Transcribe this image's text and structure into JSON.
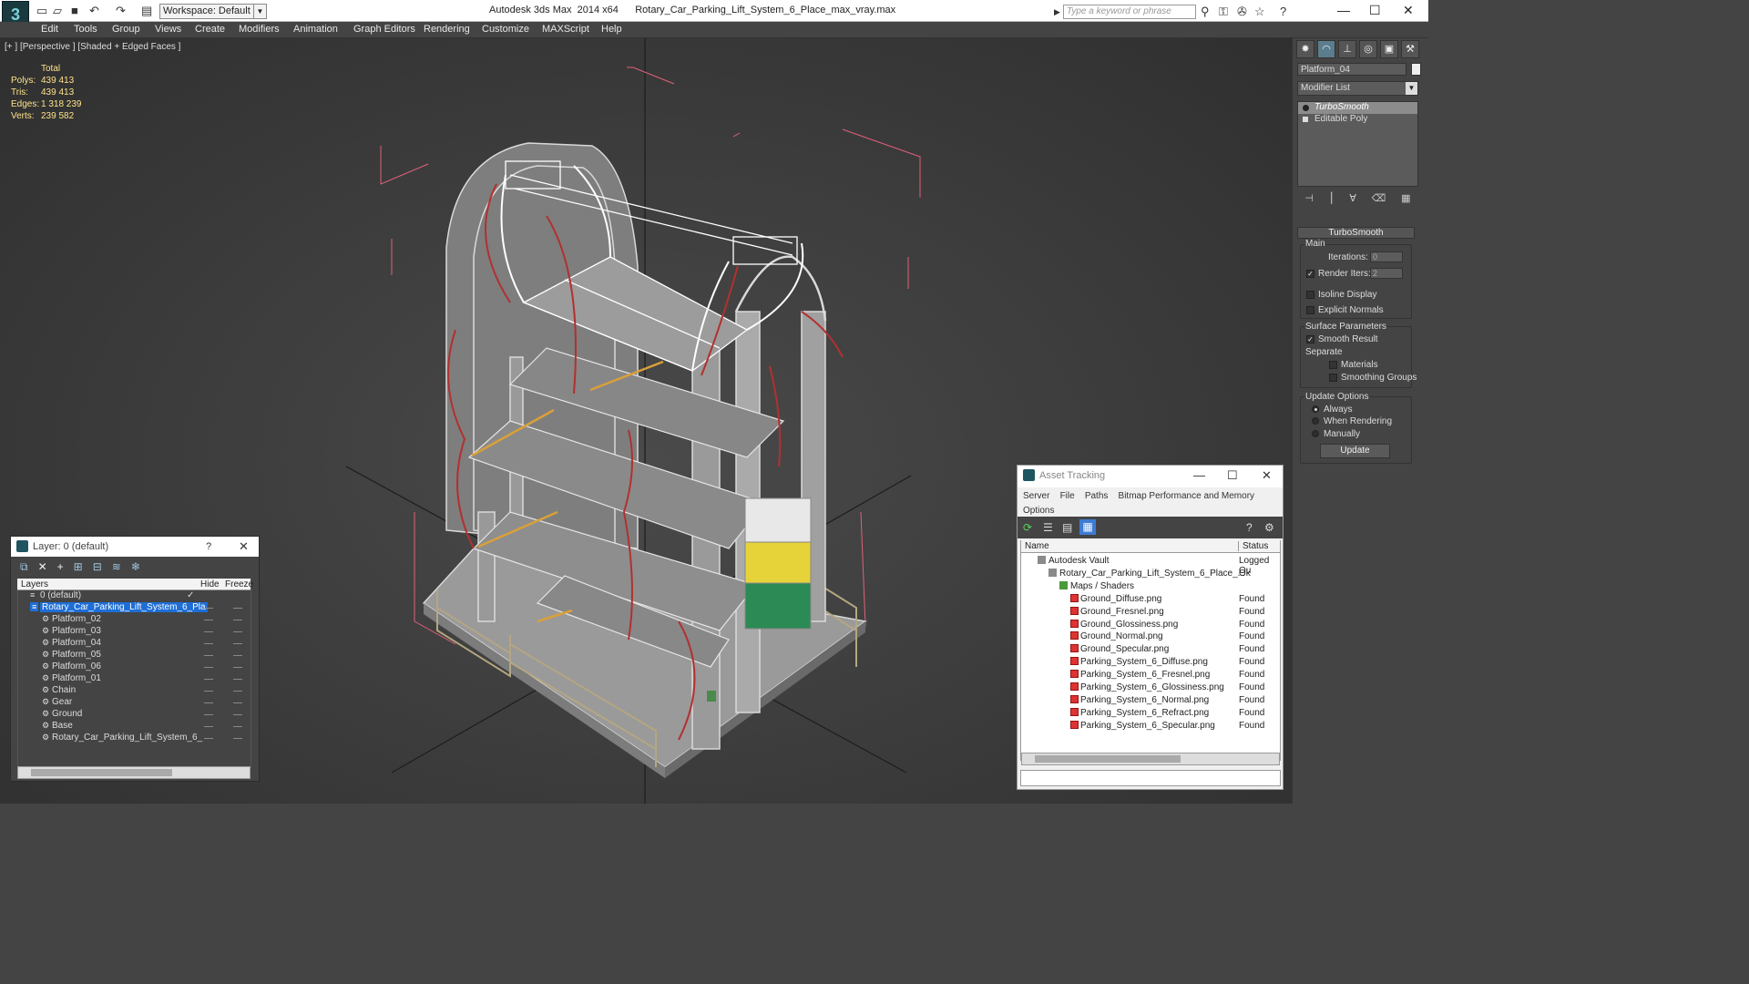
{
  "app": {
    "workspace_label": "Workspace: Default",
    "product": "Autodesk 3ds Max  2014 x64",
    "filename": "Rotary_Car_Parking_Lift_System_6_Place_max_vray.max",
    "search_placeholder": "Type a keyword or phrase"
  },
  "menu": [
    "Edit",
    "Tools",
    "Group",
    "Views",
    "Create",
    "Modifiers",
    "Animation",
    "Graph Editors",
    "Rendering",
    "Customize",
    "MAXScript",
    "Help"
  ],
  "viewport": {
    "label": "[+ ] [Perspective ] [Shaded + Edged Faces ]",
    "stats_header": "Total",
    "stats": [
      {
        "k": "Polys:",
        "v": "439 413"
      },
      {
        "k": "Tris:",
        "v": "439 413"
      },
      {
        "k": "Edges:",
        "v": "1 318 239"
      },
      {
        "k": "Verts:",
        "v": "239 582"
      }
    ]
  },
  "command_panel": {
    "object_name": "Platform_04",
    "modifier_list": "Modifier List",
    "stack": [
      "TurboSmooth",
      "Editable Poly"
    ],
    "rollout": "TurboSmooth",
    "main": "Main",
    "iterations_label": "Iterations:",
    "iterations_value": "0",
    "render_iters_label": "Render Iters:",
    "render_iters_value": "2",
    "isoline": "Isoline Display",
    "explicit": "Explicit Normals",
    "surface_params": "Surface Parameters",
    "smooth_result": "Smooth Result",
    "separate": "Separate",
    "materials": "Materials",
    "smoothing_groups": "Smoothing Groups",
    "update_options": "Update Options",
    "always": "Always",
    "when_rendering": "When Rendering",
    "manually": "Manually",
    "update_btn": "Update"
  },
  "layer_dialog": {
    "title": "Layer: 0 (default)",
    "help": "?",
    "col_layers": "Layers",
    "col_hide": "Hide",
    "col_freeze": "Freeze",
    "rows": [
      {
        "name": "0 (default)",
        "indent": 1,
        "check": true
      },
      {
        "name": "Rotary_Car_Parking_Lift_System_6_Pla",
        "indent": 1,
        "sel": true
      },
      {
        "name": "Platform_02",
        "indent": 2
      },
      {
        "name": "Platform_03",
        "indent": 2
      },
      {
        "name": "Platform_04",
        "indent": 2
      },
      {
        "name": "Platform_05",
        "indent": 2
      },
      {
        "name": "Platform_06",
        "indent": 2
      },
      {
        "name": "Platform_01",
        "indent": 2
      },
      {
        "name": "Chain",
        "indent": 2
      },
      {
        "name": "Gear",
        "indent": 2
      },
      {
        "name": "Ground",
        "indent": 2
      },
      {
        "name": "Base",
        "indent": 2
      },
      {
        "name": "Rotary_Car_Parking_Lift_System_6_",
        "indent": 2
      }
    ]
  },
  "asset_dialog": {
    "title": "Asset Tracking",
    "menu": [
      "Server",
      "File",
      "Paths",
      "Bitmap Performance and Memory",
      "Options"
    ],
    "col_name": "Name",
    "col_status": "Status",
    "rows": [
      {
        "name": "Autodesk Vault",
        "status": "Logged Ou",
        "indent": 1
      },
      {
        "name": "Rotary_Car_Parking_Lift_System_6_Place_...",
        "status": "Ok",
        "indent": 2
      },
      {
        "name": "Maps / Shaders",
        "status": "",
        "indent": 3
      },
      {
        "name": "Ground_Diffuse.png",
        "status": "Found",
        "indent": 4
      },
      {
        "name": "Ground_Fresnel.png",
        "status": "Found",
        "indent": 4
      },
      {
        "name": "Ground_Glossiness.png",
        "status": "Found",
        "indent": 4
      },
      {
        "name": "Ground_Normal.png",
        "status": "Found",
        "indent": 4
      },
      {
        "name": "Ground_Specular.png",
        "status": "Found",
        "indent": 4
      },
      {
        "name": "Parking_System_6_Diffuse.png",
        "status": "Found",
        "indent": 4
      },
      {
        "name": "Parking_System_6_Fresnel.png",
        "status": "Found",
        "indent": 4
      },
      {
        "name": "Parking_System_6_Glossiness.png",
        "status": "Found",
        "indent": 4
      },
      {
        "name": "Parking_System_6_Normal.png",
        "status": "Found",
        "indent": 4
      },
      {
        "name": "Parking_System_6_Refract.png",
        "status": "Found",
        "indent": 4
      },
      {
        "name": "Parking_System_6_Specular.png",
        "status": "Found",
        "indent": 4
      }
    ]
  },
  "colors": {
    "accent": "#1e6ed6",
    "stats": "#ffe38a",
    "bbox": "#e0607a",
    "chain": "#b03030",
    "selected_wire": "#ffffff"
  }
}
